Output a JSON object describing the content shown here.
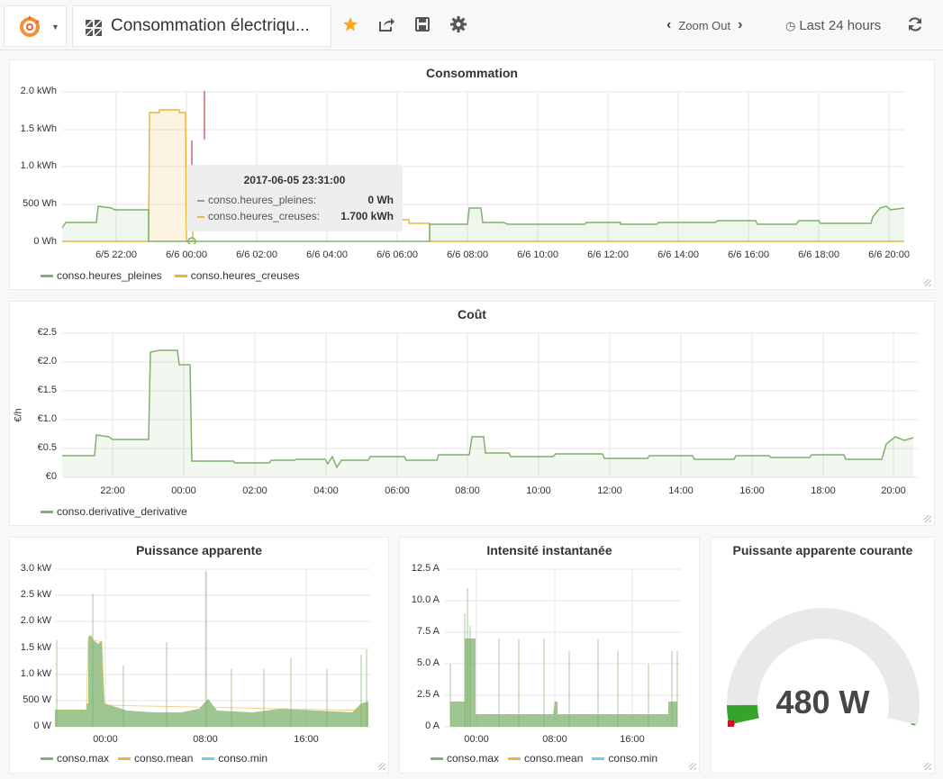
{
  "topbar": {
    "dashboard_title": "Consommation électriqu...",
    "zoom_out_label": "Zoom Out",
    "time_range": "Last 24 hours"
  },
  "consommation": {
    "title": "Consommation",
    "y_ticks": [
      "2.0 kWh",
      "1.5 kWh",
      "1.0 kWh",
      "500 Wh",
      "0 Wh"
    ],
    "x_ticks": [
      "6/5 22:00",
      "6/6 00:00",
      "6/6 02:00",
      "6/6 04:00",
      "6/6 06:00",
      "6/6 08:00",
      "6/6 10:00",
      "6/6 12:00",
      "6/6 14:00",
      "6/6 16:00",
      "6/6 18:00",
      "6/6 20:00"
    ],
    "legend": [
      "conso.heures_pleines",
      "conso.heures_creuses"
    ],
    "tooltip": {
      "time": "2017-06-05 23:31:00",
      "rows": [
        {
          "name": "conso.heures_pleines:",
          "value": "0 Wh"
        },
        {
          "name": "conso.heures_creuses:",
          "value": "1.700 kWh"
        }
      ]
    }
  },
  "cout": {
    "title": "Coût",
    "ylabel": "€/h",
    "y_ticks": [
      "€2.5",
      "€2.0",
      "€1.5",
      "€1.0",
      "€0.5",
      "€0"
    ],
    "x_ticks": [
      "22:00",
      "00:00",
      "02:00",
      "04:00",
      "06:00",
      "08:00",
      "10:00",
      "12:00",
      "14:00",
      "16:00",
      "18:00",
      "20:00"
    ],
    "legend": [
      "conso.derivative_derivative"
    ]
  },
  "puissance": {
    "title": "Puissance apparente",
    "y_ticks": [
      "3.0 kW",
      "2.5 kW",
      "2.0 kW",
      "1.5 kW",
      "1.0 kW",
      "500 W",
      "0 W"
    ],
    "x_ticks": [
      "00:00",
      "08:00",
      "16:00"
    ],
    "legend": [
      "conso.max",
      "conso.mean",
      "conso.min"
    ]
  },
  "intensite": {
    "title": "Intensité instantanée",
    "y_ticks": [
      "12.5 A",
      "10.0 A",
      "7.5 A",
      "5.0 A",
      "2.5 A",
      "0 A"
    ],
    "x_ticks": [
      "00:00",
      "08:00",
      "16:00"
    ],
    "legend": [
      "conso.max",
      "conso.mean",
      "conso.min"
    ]
  },
  "gauge": {
    "title": "Puissante apparente courante",
    "value": "480 W",
    "value_watts": 480
  },
  "colors": {
    "green": "#7eb26d",
    "yellow": "#eab839",
    "cyan": "#6ed0e0",
    "red": "#e24d42",
    "gauge_green": "#37a32b"
  },
  "chart_data": [
    {
      "type": "line",
      "title": "Consommation",
      "x": [
        "6/5 22:00",
        "6/6 00:00",
        "6/6 02:00",
        "6/6 04:00",
        "6/6 06:00",
        "6/6 08:00",
        "6/6 10:00",
        "6/6 12:00",
        "6/6 14:00",
        "6/6 16:00",
        "6/6 18:00",
        "6/6 20:00"
      ],
      "series": [
        {
          "name": "conso.heures_pleines",
          "values": [
            430,
            0,
            0,
            0,
            0,
            440,
            200,
            210,
            230,
            210,
            230,
            430
          ]
        },
        {
          "name": "conso.heures_creuses",
          "values": [
            0,
            1700,
            210,
            200,
            200,
            0,
            0,
            0,
            0,
            0,
            0,
            0
          ]
        }
      ],
      "ylim": [
        0,
        2000
      ]
    },
    {
      "type": "line",
      "title": "Coût",
      "ylabel": "€/h",
      "x": [
        "22:00",
        "00:00",
        "02:00",
        "04:00",
        "06:00",
        "08:00",
        "10:00",
        "12:00",
        "14:00",
        "16:00",
        "18:00",
        "20:00"
      ],
      "series": [
        {
          "name": "conso.derivative_derivative",
          "values": [
            0.65,
            2.2,
            0.3,
            0.3,
            0.3,
            0.7,
            0.3,
            0.35,
            0.3,
            0.35,
            0.3,
            0.7
          ]
        }
      ],
      "ylim": [
        0,
        2.5
      ]
    },
    {
      "type": "bar",
      "title": "Puissance apparente",
      "x": [
        "00:00",
        "08:00",
        "16:00"
      ],
      "series": [
        {
          "name": "conso.max",
          "values": [
            1700,
            300,
            350
          ]
        }
      ],
      "ylim": [
        0,
        3000
      ]
    },
    {
      "type": "bar",
      "title": "Intensité instantanée",
      "x": [
        "00:00",
        "08:00",
        "16:00"
      ],
      "series": [
        {
          "name": "conso.max",
          "values": [
            7,
            1,
            1
          ]
        }
      ],
      "ylim": [
        0,
        12.5
      ]
    }
  ]
}
